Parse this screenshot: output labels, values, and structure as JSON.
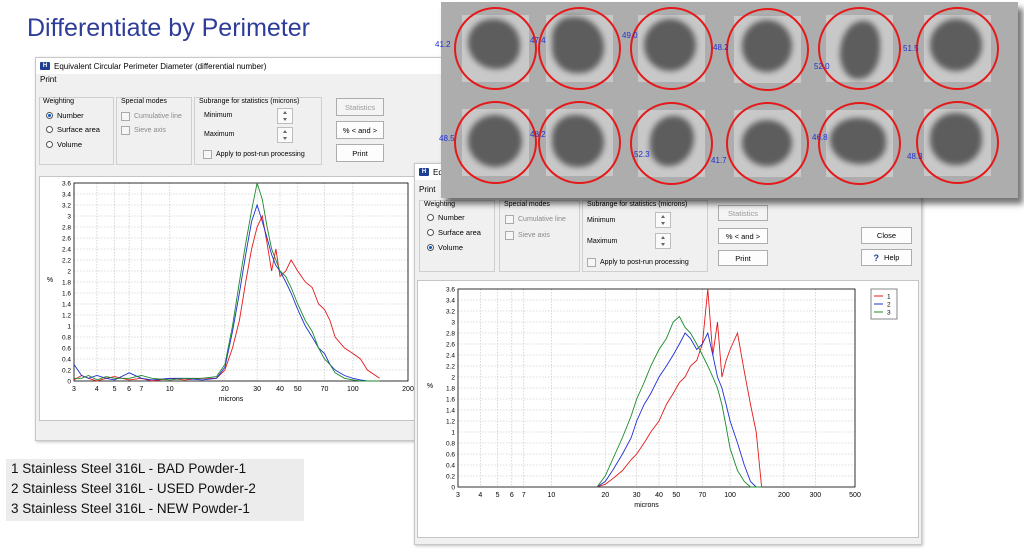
{
  "slide_title": "Differentiate by Perimeter",
  "colors": {
    "series1": "#e41a1a",
    "series2": "#1f2fd6",
    "series3": "#1a8a2a",
    "title": "#2e3d9a",
    "ring": "#e41a1a"
  },
  "window1": {
    "title": "Equivalent Circular Perimeter Diameter  (differential number)",
    "menu": "Print",
    "weighting": {
      "label": "Weighting",
      "options": [
        "Number",
        "Surface area",
        "Volume"
      ],
      "selected": "Number"
    },
    "special": {
      "label": "Special modes",
      "options": [
        "Cumulative line",
        "Sieve axis"
      ]
    },
    "subrange": {
      "label": "Subrange for statistics (microns)",
      "min_label": "Minimum",
      "max_label": "Maximum",
      "apply_label": "Apply to post-run processing"
    },
    "buttons": {
      "statistics": "Statistics",
      "percent": "% < and >",
      "print": "Print"
    }
  },
  "window2": {
    "title": "Eq",
    "menu": "Print",
    "weighting": {
      "label": "Weighting",
      "options": [
        "Number",
        "Surface area",
        "Volume"
      ],
      "selected": "Volume"
    },
    "special": {
      "label": "Special modes",
      "options": [
        "Cumulative line",
        "Sieve axis"
      ]
    },
    "subrange": {
      "label": "Subrange for statistics (microns)",
      "min_label": "Minimum",
      "max_label": "Maximum",
      "apply_label": "Apply to post-run processing"
    },
    "buttons": {
      "statistics": "Statistics",
      "percent": "% < and >",
      "print": "Print",
      "close": "Close",
      "help": "Help",
      "help_icon": "?"
    }
  },
  "particles": {
    "labels": [
      "41.2",
      "47.4",
      "49.0",
      "48.2",
      "52.0",
      "51.5",
      "48.5",
      "48.2",
      "52.3",
      "41.7",
      "46.8",
      "48.3"
    ]
  },
  "sample_legend": [
    "1  Stainless Steel 316L - BAD Powder-1",
    "2  Stainless Steel 316L - USED Powder-2",
    "3  Stainless Steel 316L - NEW Powder-1"
  ],
  "chart_data": [
    {
      "type": "line",
      "title": "",
      "xlabel": "microns",
      "ylabel": "%",
      "xscale": "log",
      "xlim": [
        3,
        200
      ],
      "ylim": [
        0,
        3.6
      ],
      "grid": true,
      "xticks": [
        3,
        4,
        5,
        6,
        7,
        10,
        20,
        30,
        40,
        50,
        70,
        100,
        200
      ],
      "yticks": [
        0,
        0.2,
        0.4,
        0.6,
        0.8,
        1,
        1.2,
        1.4,
        1.6,
        1.8,
        2,
        2.2,
        2.4,
        2.6,
        2.8,
        3,
        3.2,
        3.4,
        3.6
      ],
      "x": [
        3,
        3.3,
        3.6,
        4,
        4.5,
        5,
        6,
        7,
        8,
        10,
        12,
        15,
        18,
        20,
        22,
        24,
        26,
        28,
        30,
        32,
        34,
        36,
        38,
        40,
        43,
        46,
        50,
        55,
        60,
        65,
        70,
        75,
        80,
        90,
        100,
        110,
        120,
        140
      ],
      "series": [
        {
          "values": [
            0.02,
            0.1,
            0.05,
            0.0,
            0.05,
            0.08,
            0.02,
            0.05,
            0.0,
            0.05,
            0.02,
            0.05,
            0.05,
            0.2,
            0.6,
            1.1,
            1.8,
            2.4,
            2.8,
            3.0,
            2.5,
            2.0,
            2.4,
            1.9,
            2.0,
            2.2,
            2.0,
            1.8,
            1.7,
            1.4,
            1.3,
            1.1,
            0.8,
            0.6,
            0.5,
            0.4,
            0.2,
            0.05
          ]
        },
        {
          "values": [
            0.3,
            0.1,
            0.05,
            0.1,
            0.05,
            0.02,
            0.15,
            0.05,
            0.02,
            0.05,
            0.05,
            0.02,
            0.05,
            0.25,
            0.9,
            1.6,
            2.3,
            2.9,
            3.2,
            2.9,
            2.6,
            2.3,
            2.1,
            2.0,
            1.8,
            1.6,
            1.3,
            1.0,
            0.8,
            0.6,
            0.5,
            0.3,
            0.2,
            0.1,
            0.05,
            0.02,
            0.0,
            0.0
          ]
        },
        {
          "values": [
            0.05,
            0.05,
            0.1,
            0.02,
            0.08,
            0.05,
            0.05,
            0.1,
            0.05,
            0.02,
            0.05,
            0.05,
            0.08,
            0.3,
            1.0,
            1.8,
            2.5,
            3.1,
            3.6,
            3.3,
            2.8,
            2.4,
            2.2,
            2.0,
            1.9,
            1.7,
            1.4,
            1.1,
            0.9,
            0.6,
            0.4,
            0.3,
            0.15,
            0.05,
            0.02,
            0.0,
            0.0,
            0.0
          ]
        }
      ]
    },
    {
      "type": "line",
      "title": "",
      "xlabel": "microns",
      "ylabel": "%",
      "xscale": "log",
      "xlim": [
        3,
        500
      ],
      "ylim": [
        0,
        3.6
      ],
      "grid": true,
      "legend": [
        "1",
        "2",
        "3"
      ],
      "legend_position": "top-right",
      "xticks": [
        3,
        4,
        5,
        6,
        7,
        10,
        20,
        30,
        40,
        50,
        70,
        100,
        200,
        300,
        500
      ],
      "yticks": [
        0,
        0.2,
        0.4,
        0.6,
        0.8,
        1,
        1.2,
        1.4,
        1.6,
        1.8,
        2,
        2.2,
        2.4,
        2.6,
        2.8,
        3,
        3.2,
        3.4,
        3.6
      ],
      "x": [
        18,
        20,
        22,
        25,
        28,
        30,
        33,
        36,
        40,
        44,
        48,
        52,
        56,
        60,
        65,
        70,
        75,
        80,
        85,
        90,
        95,
        100,
        110,
        120,
        130,
        140,
        150
      ],
      "series": [
        {
          "name": "1",
          "values": [
            0.0,
            0.05,
            0.15,
            0.3,
            0.5,
            0.6,
            0.8,
            1.0,
            1.2,
            1.5,
            1.7,
            1.9,
            2.0,
            2.2,
            2.3,
            2.6,
            3.6,
            2.4,
            3.0,
            2.0,
            2.3,
            2.5,
            2.8,
            2.1,
            1.5,
            1.0,
            0.0
          ]
        },
        {
          "name": "2",
          "values": [
            0.0,
            0.1,
            0.3,
            0.6,
            0.9,
            1.2,
            1.5,
            1.7,
            2.0,
            2.2,
            2.4,
            2.6,
            2.8,
            2.7,
            2.5,
            2.6,
            2.8,
            2.4,
            2.0,
            1.8,
            1.5,
            1.2,
            0.8,
            0.4,
            0.1,
            0.0,
            0.0
          ]
        },
        {
          "name": "3",
          "values": [
            0.0,
            0.2,
            0.5,
            0.9,
            1.3,
            1.6,
            1.9,
            2.2,
            2.5,
            2.7,
            3.0,
            3.1,
            2.9,
            2.8,
            2.6,
            2.4,
            2.2,
            2.0,
            1.8,
            1.5,
            1.1,
            0.7,
            0.3,
            0.1,
            0.0,
            0.0,
            0.0
          ]
        }
      ]
    }
  ]
}
